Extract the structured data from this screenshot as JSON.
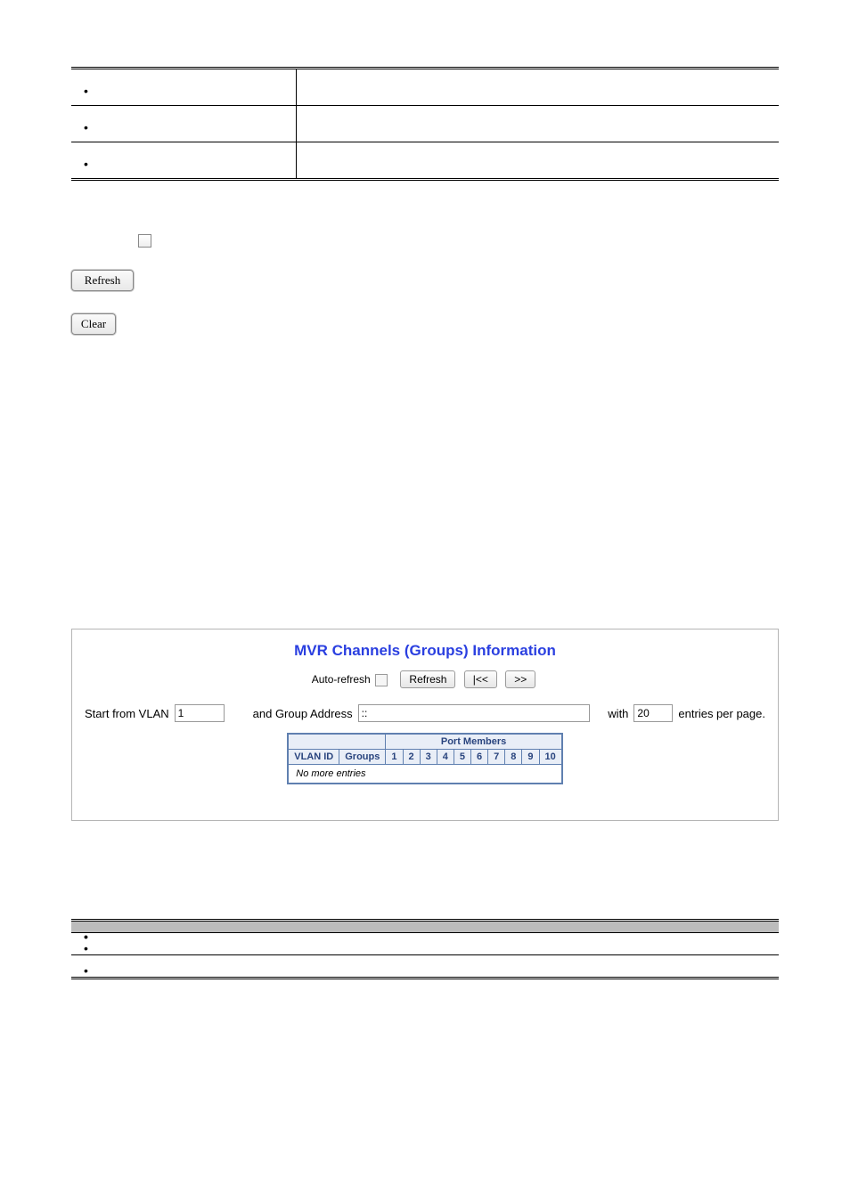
{
  "defs_top": [
    {
      "term": "",
      "desc": ""
    },
    {
      "term": "",
      "desc": ""
    },
    {
      "term": "",
      "desc": ""
    }
  ],
  "top_buttons": {
    "refresh": "Refresh",
    "clear": "Clear"
  },
  "shot": {
    "title": "MVR Channels (Groups) Information",
    "autorefresh_label": "Auto-refresh",
    "btn_refresh": "Refresh",
    "btn_first": "|<<",
    "btn_next": ">>",
    "start_label": "Start from VLAN",
    "vlan_value": "1",
    "addr_label": "and Group Address",
    "addr_value": "::",
    "with_label": "with",
    "per_value": "20",
    "per_suffix": "entries per page.",
    "table": {
      "group_header": "Port Members",
      "col_vlan": "VLAN ID",
      "col_groups": "Groups",
      "ports": [
        "1",
        "2",
        "3",
        "4",
        "5",
        "6",
        "7",
        "8",
        "9",
        "10"
      ],
      "empty": "No more entries"
    }
  },
  "defs_bottom": {
    "head_left": "",
    "head_right": "",
    "rows": [
      {
        "term": "",
        "desc": ""
      },
      {
        "term": "",
        "desc": ""
      }
    ]
  }
}
